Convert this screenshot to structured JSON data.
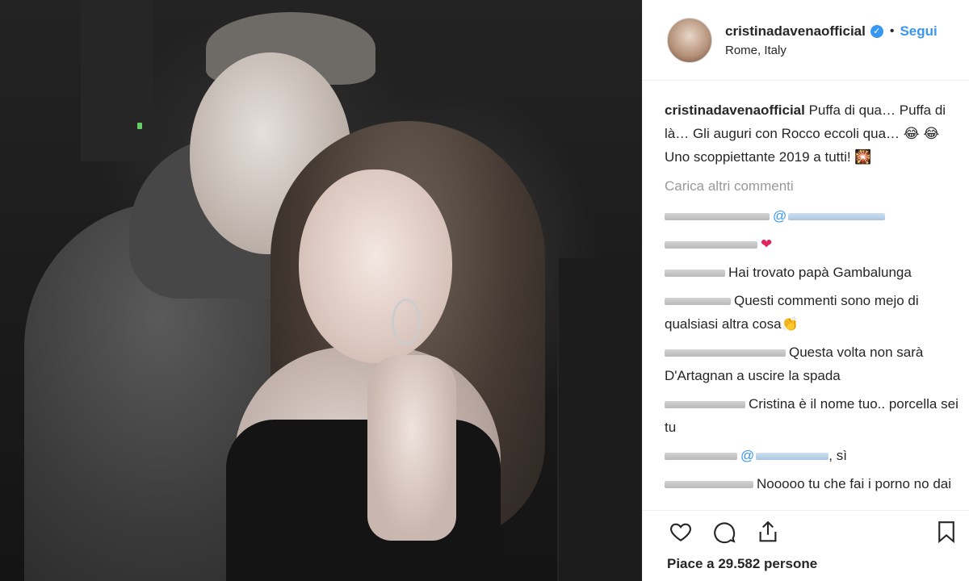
{
  "post": {
    "username": "cristinadavenaofficial",
    "follow_label": "Segui",
    "separator": "•",
    "location": "Rome, Italy",
    "caption_text": "Puffa di qua… Puffa di là… Gli auguri con Rocco eccoli qua… 😂 😂 Uno scoppiettante 2019 a tutti! 🎇",
    "load_more": "Carica altri commenti",
    "likes_text": "Piace a 29.582 persone"
  },
  "comments": [
    {
      "user_len": 130,
      "text": "",
      "mention_len": 120,
      "suffix": ""
    },
    {
      "user_len": 115,
      "text": "",
      "mention_len": 0,
      "suffix": "❤"
    },
    {
      "user_len": 75,
      "text": "Hai trovato papà Gambalunga",
      "mention_len": 0,
      "suffix": ""
    },
    {
      "user_len": 82,
      "text": "Questi commenti sono mejo di qualsiasi altra cosa👏",
      "mention_len": 0,
      "suffix": ""
    },
    {
      "user_len": 150,
      "text": "Questa volta non sarà D'Artagnan a uscire la spada",
      "mention_len": 0,
      "suffix": ""
    },
    {
      "user_len": 100,
      "text": "Cristina è il nome tuo.. porcella sei tu",
      "mention_len": 0,
      "suffix": ""
    },
    {
      "user_len": 90,
      "text": "",
      "mention_len": 90,
      "suffix": ", sì"
    },
    {
      "user_len": 110,
      "text": "Nooooo tu che fai i porno no dai sei la regina dei bambini 😱",
      "mention_len": 0,
      "suffix": ""
    },
    {
      "user_len": 150,
      "text": "",
      "mention_len": 0,
      "suffix": "👍 💯 👍"
    }
  ],
  "icons": [
    "heart-icon",
    "comment-icon",
    "share-icon",
    "bookmark-icon",
    "verified-badge-icon"
  ],
  "colors": {
    "accent": "#3897f0",
    "text": "#262626",
    "muted": "#999999",
    "border": "#efefef"
  }
}
